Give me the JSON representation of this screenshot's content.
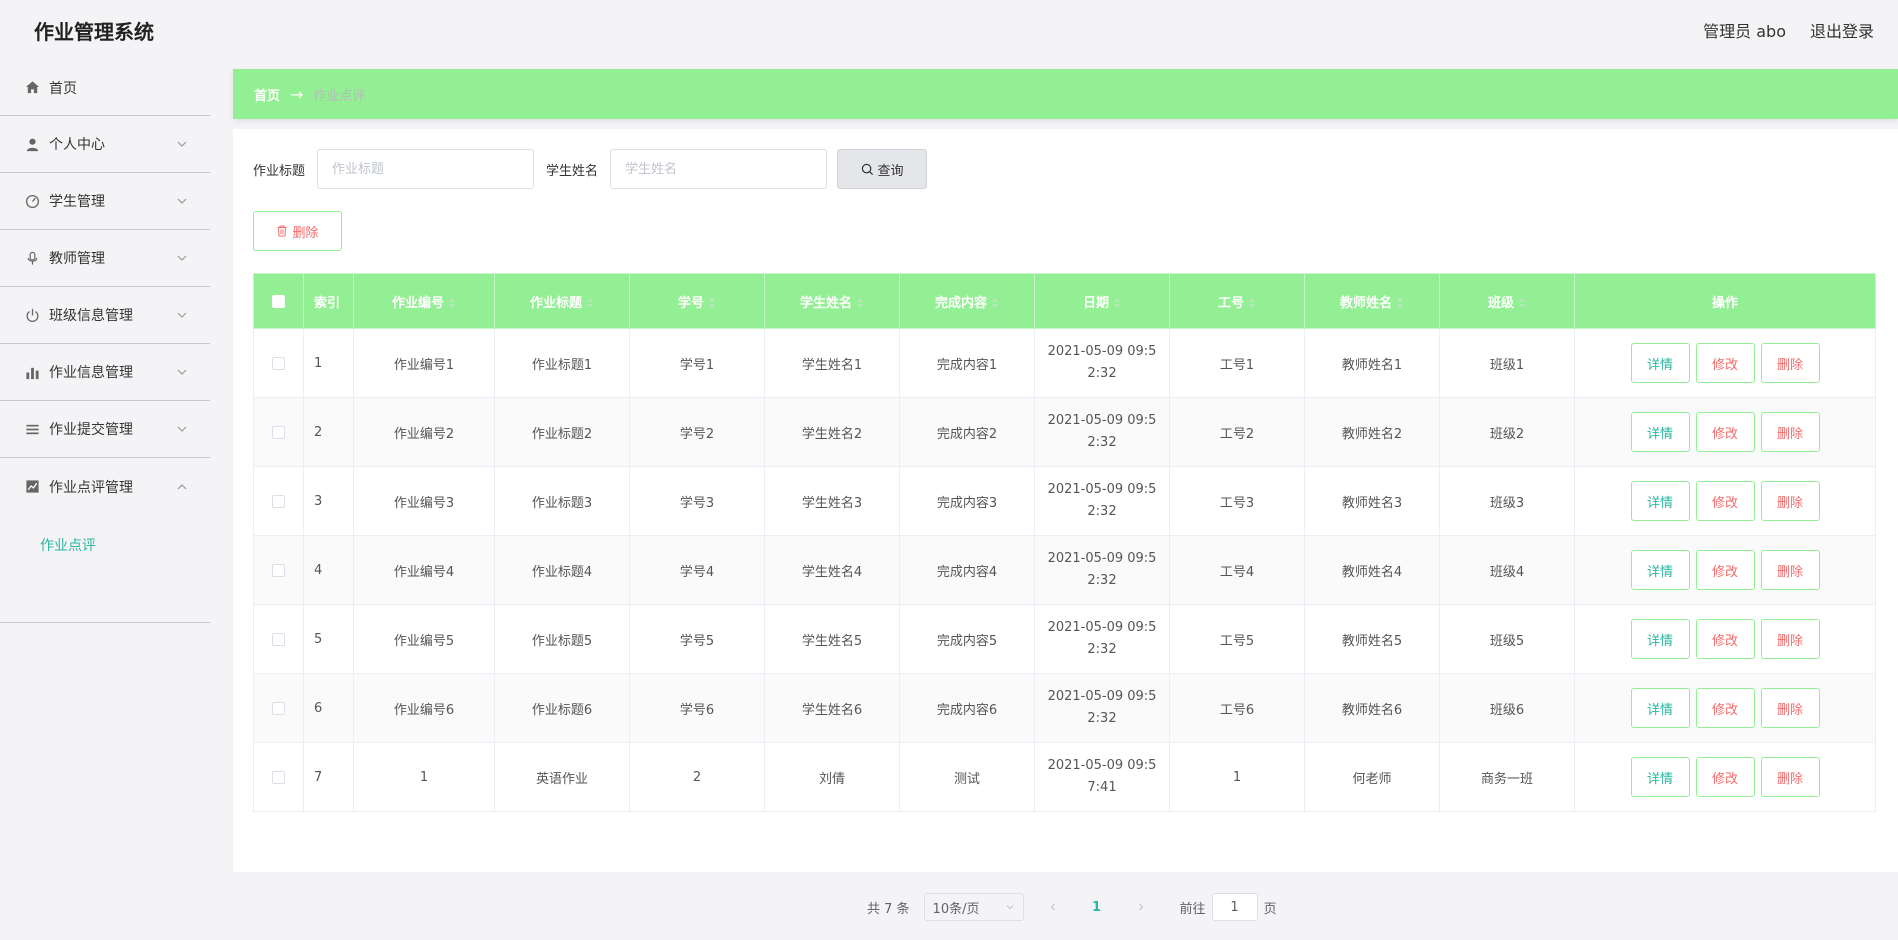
{
  "app": {
    "title": "作业管理系统",
    "user_label": "管理员 abo",
    "logout_label": "退出登录"
  },
  "sidebar": {
    "items": [
      {
        "label": "首页",
        "icon": "home-icon"
      },
      {
        "label": "个人中心",
        "icon": "user-icon"
      },
      {
        "label": "学生管理",
        "icon": "gauge-icon"
      },
      {
        "label": "教师管理",
        "icon": "microphone-icon"
      },
      {
        "label": "班级信息管理",
        "icon": "power-icon"
      },
      {
        "label": "作业信息管理",
        "icon": "bar-chart-icon"
      },
      {
        "label": "作业提交管理",
        "icon": "list-icon"
      },
      {
        "label": "作业点评管理",
        "icon": "line-chart-icon"
      }
    ],
    "sub_item": "作业点评"
  },
  "breadcrumb": {
    "home": "首页",
    "separator": "→",
    "current": "作业点评"
  },
  "search": {
    "title_label": "作业标题",
    "title_placeholder": "作业标题",
    "student_label": "学生姓名",
    "student_placeholder": "学生姓名",
    "query_label": "查询"
  },
  "delete_label": "删除",
  "table": {
    "headers": [
      "索引",
      "作业编号",
      "作业标题",
      "学号",
      "学生姓名",
      "完成内容",
      "日期",
      "工号",
      "教师姓名",
      "班级",
      "操作"
    ],
    "rows": [
      {
        "index": "1",
        "code": "作业编号1",
        "title": "作业标题1",
        "sid": "学号1",
        "sname": "学生姓名1",
        "content": "完成内容1",
        "date1": "2021-05-09 09:5",
        "date2": "2:32",
        "tid": "工号1",
        "tname": "教师姓名1",
        "cls": "班级1"
      },
      {
        "index": "2",
        "code": "作业编号2",
        "title": "作业标题2",
        "sid": "学号2",
        "sname": "学生姓名2",
        "content": "完成内容2",
        "date1": "2021-05-09 09:5",
        "date2": "2:32",
        "tid": "工号2",
        "tname": "教师姓名2",
        "cls": "班级2"
      },
      {
        "index": "3",
        "code": "作业编号3",
        "title": "作业标题3",
        "sid": "学号3",
        "sname": "学生姓名3",
        "content": "完成内容3",
        "date1": "2021-05-09 09:5",
        "date2": "2:32",
        "tid": "工号3",
        "tname": "教师姓名3",
        "cls": "班级3"
      },
      {
        "index": "4",
        "code": "作业编号4",
        "title": "作业标题4",
        "sid": "学号4",
        "sname": "学生姓名4",
        "content": "完成内容4",
        "date1": "2021-05-09 09:5",
        "date2": "2:32",
        "tid": "工号4",
        "tname": "教师姓名4",
        "cls": "班级4"
      },
      {
        "index": "5",
        "code": "作业编号5",
        "title": "作业标题5",
        "sid": "学号5",
        "sname": "学生姓名5",
        "content": "完成内容5",
        "date1": "2021-05-09 09:5",
        "date2": "2:32",
        "tid": "工号5",
        "tname": "教师姓名5",
        "cls": "班级5"
      },
      {
        "index": "6",
        "code": "作业编号6",
        "title": "作业标题6",
        "sid": "学号6",
        "sname": "学生姓名6",
        "content": "完成内容6",
        "date1": "2021-05-09 09:5",
        "date2": "2:32",
        "tid": "工号6",
        "tname": "教师姓名6",
        "cls": "班级6"
      },
      {
        "index": "7",
        "code": "1",
        "title": "英语作业",
        "sid": "2",
        "sname": "刘倩",
        "content": "测试",
        "date1": "2021-05-09 09:5",
        "date2": "7:41",
        "tid": "1",
        "tname": "何老师",
        "cls": "商务一班"
      }
    ],
    "actions": {
      "detail": "详情",
      "edit": "修改",
      "delete": "删除"
    }
  },
  "pagination": {
    "total": "共 7 条",
    "page_size": "10条/页",
    "current_page": "1",
    "goto_prefix": "前往",
    "goto_value": "1",
    "goto_suffix": "页"
  },
  "colors": {
    "accent_green": "#93ef93",
    "link_teal": "#2bb6a2",
    "danger_red": "#f56c6c"
  }
}
